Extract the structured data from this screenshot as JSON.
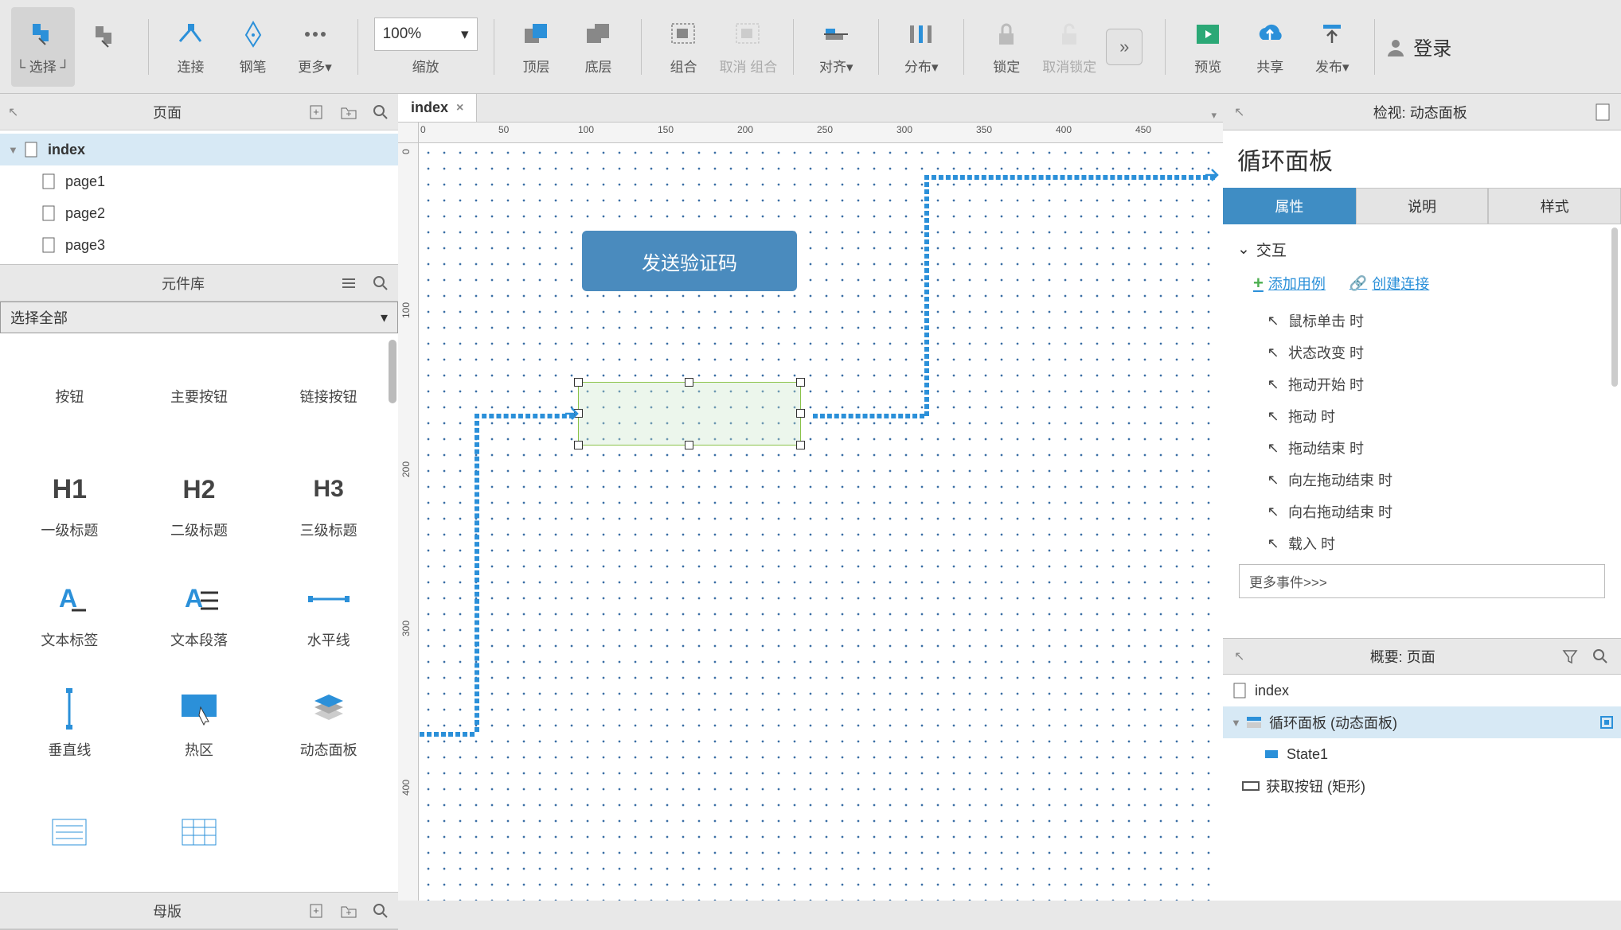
{
  "toolbar": {
    "select": "选择",
    "connect": "连接",
    "pen": "钢笔",
    "more": "更多",
    "zoom": "缩放",
    "zoom_value": "100%",
    "front": "顶层",
    "back": "底层",
    "group": "组合",
    "ungroup": "取消 组合",
    "align": "对齐",
    "distribute": "分布",
    "lock": "锁定",
    "unlock": "取消锁定",
    "preview": "预览",
    "share": "共享",
    "publish": "发布",
    "login": "登录"
  },
  "pages_panel": {
    "title": "页面",
    "items": [
      "index",
      "page1",
      "page2",
      "page3"
    ]
  },
  "widget_lib": {
    "title": "元件库",
    "select_label": "选择全部",
    "items": [
      {
        "label": "按钮"
      },
      {
        "label": "主要按钮"
      },
      {
        "label": "链接按钮"
      },
      {
        "label": "一级标题",
        "preview": "H1"
      },
      {
        "label": "二级标题",
        "preview": "H2"
      },
      {
        "label": "三级标题",
        "preview": "H3"
      },
      {
        "label": "文本标签"
      },
      {
        "label": "文本段落"
      },
      {
        "label": "水平线"
      },
      {
        "label": "垂直线"
      },
      {
        "label": "热区"
      },
      {
        "label": "动态面板"
      }
    ]
  },
  "masters_panel": {
    "title": "母版"
  },
  "canvas": {
    "tab": "index",
    "button_text": "发送验证码",
    "ruler_ticks": [
      "0",
      "50",
      "100",
      "150",
      "200",
      "250",
      "300",
      "350",
      "400",
      "450"
    ],
    "ruler_v": [
      "0",
      "100",
      "200",
      "300",
      "400"
    ]
  },
  "inspector": {
    "title": "检视: 动态面板",
    "widget_name": "循环面板",
    "tabs": {
      "props": "属性",
      "notes": "说明",
      "style": "样式"
    },
    "interactions_label": "交互",
    "add_case": "添加用例",
    "create_link": "创建连接",
    "events": [
      "鼠标单击 时",
      "状态改变 时",
      "拖动开始 时",
      "拖动 时",
      "拖动结束 时",
      "向左拖动结束 时",
      "向右拖动结束 时",
      "载入 时"
    ],
    "more_events": "更多事件>>>"
  },
  "outline": {
    "title": "概要: 页面",
    "items": [
      {
        "label": "index",
        "depth": 0,
        "icon": "page"
      },
      {
        "label": "循环面板 (动态面板)",
        "depth": 1,
        "icon": "panel",
        "selected": true
      },
      {
        "label": "State1",
        "depth": 2,
        "icon": "state"
      },
      {
        "label": "获取按钮 (矩形)",
        "depth": 1,
        "icon": "rect"
      }
    ]
  }
}
